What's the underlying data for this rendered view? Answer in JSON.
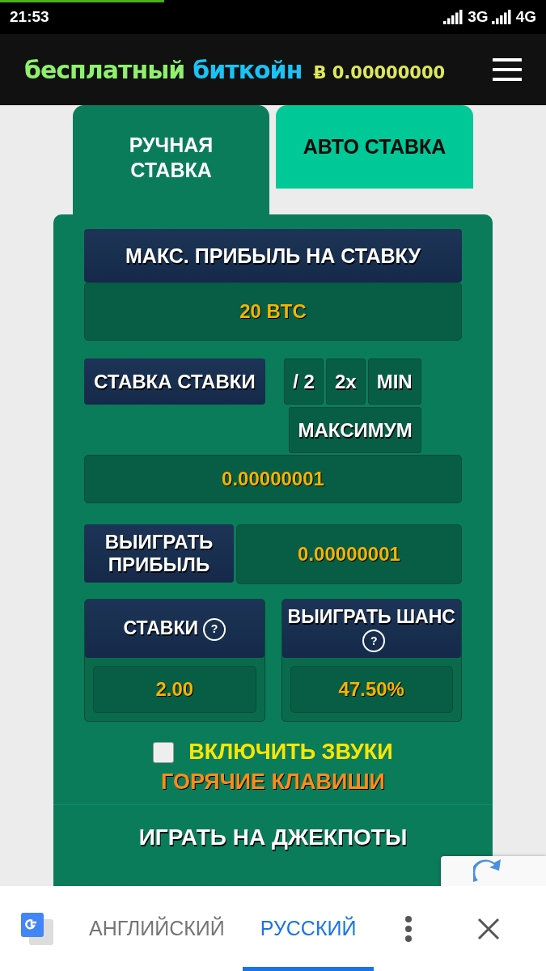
{
  "status_bar": {
    "time": "21:53",
    "network_1": "3G",
    "network_2": "4G"
  },
  "header": {
    "logo_part_1": "бесплатный",
    "logo_part_2": "биткойн",
    "balance": "Ƀ 0.00000000"
  },
  "tabs": [
    {
      "label": "РУЧНАЯ СТАВКА",
      "selected": true
    },
    {
      "label": "АВТО СТАВКА",
      "selected": false
    }
  ],
  "max_profit": {
    "title": "МАКС. ПРИБЫЛЬ НА СТАВКУ",
    "value": "20 BTC"
  },
  "bet": {
    "label": "СТАВКА СТАВКИ",
    "buttons": [
      "/ 2",
      "2x",
      "MIN",
      "МАКСИМУМ"
    ],
    "value": "0.00000001"
  },
  "win_profit": {
    "label": "ВЫИГРАТЬ ПРИБЫЛЬ",
    "value": "0.00000001"
  },
  "stats": [
    {
      "label": "СТАВКИ",
      "help": "?",
      "value": "2.00"
    },
    {
      "label": "ВЫИГРАТЬ ШАНС",
      "help": "?",
      "value": "47.50%"
    }
  ],
  "sounds": {
    "label": "ВКЛЮЧИТЬ ЗВУКИ",
    "checked": false
  },
  "hotkeys": "ГОРЯЧИЕ КЛАВИШИ",
  "jackpot": "ИГРАТЬ НА ДЖЕКПОТЫ",
  "translate_bar": {
    "languages": [
      {
        "label": "АНГЛИЙСКИЙ",
        "selected": false
      },
      {
        "label": "РУССКИЙ",
        "selected": true
      }
    ]
  }
}
